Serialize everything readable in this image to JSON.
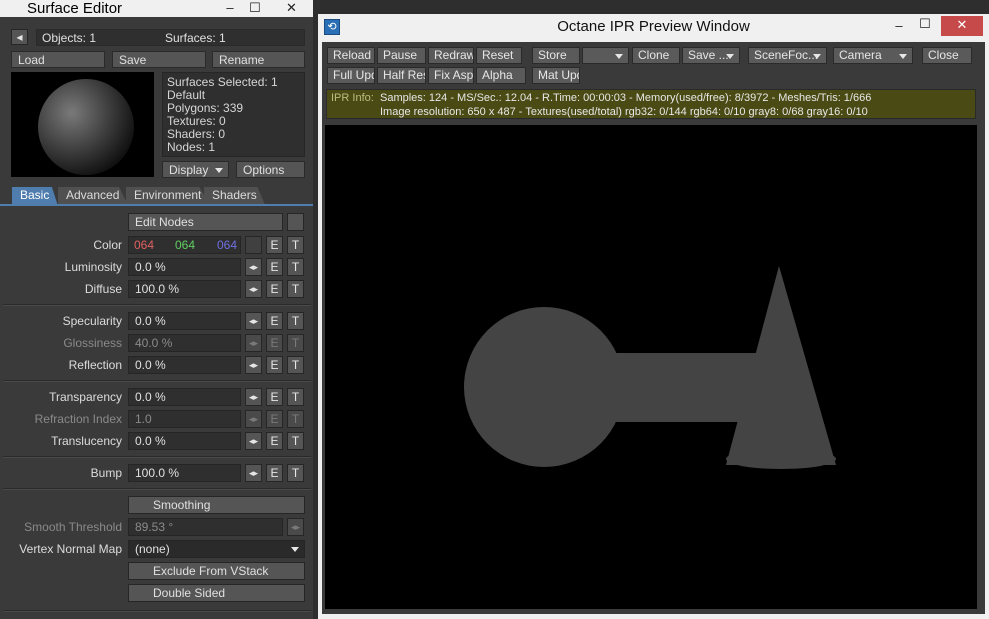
{
  "surface_editor": {
    "title": "Surface Editor",
    "window_buttons": {
      "minimize": "–",
      "maximize": "☐",
      "close": "✕"
    },
    "objects_label": "Objects: 1",
    "surfaces_label": "Surfaces: 1",
    "load": "Load",
    "save": "Save",
    "rename": "Rename",
    "info": {
      "selected": "Surfaces Selected: 1",
      "name": "Default",
      "polygons": "Polygons: 339",
      "textures": "Textures: 0",
      "shaders": "Shaders: 0",
      "nodes": "Nodes: 1"
    },
    "display": "Display",
    "options": "Options",
    "tabs": [
      "Basic",
      "Advanced",
      "Environment",
      "Shaders"
    ],
    "edit_nodes": "Edit Nodes",
    "color": {
      "label": "Color",
      "r": "064",
      "g": "064",
      "b": "064",
      "r_color": "#e06060",
      "g_color": "#60d060",
      "b_color": "#7070e0"
    },
    "luminosity": {
      "label": "Luminosity",
      "value": "0.0 %"
    },
    "diffuse": {
      "label": "Diffuse",
      "value": "100.0 %"
    },
    "specularity": {
      "label": "Specularity",
      "value": "0.0 %"
    },
    "glossiness": {
      "label": "Glossiness",
      "value": "40.0 %"
    },
    "reflection": {
      "label": "Reflection",
      "value": "0.0 %"
    },
    "transparency": {
      "label": "Transparency",
      "value": "0.0 %"
    },
    "refraction_index": {
      "label": "Refraction Index",
      "value": "1.0"
    },
    "translucency": {
      "label": "Translucency",
      "value": "0.0 %"
    },
    "bump": {
      "label": "Bump",
      "value": "100.0 %"
    },
    "smoothing": "Smoothing",
    "smooth_threshold": {
      "label": "Smooth Threshold",
      "value": "89.53 °"
    },
    "vertex_normal_map": {
      "label": "Vertex Normal Map",
      "value": "(none)"
    },
    "exclude_vstack": "Exclude From VStack",
    "double_sided": "Double Sided",
    "env_letter": "E",
    "tex_letter": "T",
    "stepper_glyph": "◂▸"
  },
  "ipr": {
    "title": "Octane IPR Preview Window",
    "window_buttons": {
      "minimize": "–",
      "maximize": "☐",
      "close": "✕"
    },
    "toolbar_row1": [
      {
        "label": "Reload"
      },
      {
        "label": "Pause"
      },
      {
        "label": "Redraw"
      },
      {
        "label": "Reset"
      },
      {
        "label": "Store"
      },
      {
        "label": ""
      },
      {
        "label": "Clone"
      },
      {
        "label": "Save ..."
      },
      {
        "label": "SceneFoc..."
      },
      {
        "label": "Camera"
      },
      {
        "label": "Close"
      }
    ],
    "toolbar_row2": [
      {
        "label": "Full Upd."
      },
      {
        "label": "Half Res"
      },
      {
        "label": "Fix Asp."
      },
      {
        "label": "Alpha"
      },
      {
        "label": "Mat Upd"
      }
    ],
    "info_label": "IPR Info:",
    "info_line1": "Samples: 124  -  MS/Sec.: 12.04  -  R.Time: 00:00:03 - Memory(used/free): 8/3972  -  Meshes/Tris: 1/666",
    "info_line2": "Image resolution: 650 x 487 - Textures(used/total) rgb32: 0/144   rgb64: 0/10   gray8: 0/68   gray16: 0/10"
  }
}
